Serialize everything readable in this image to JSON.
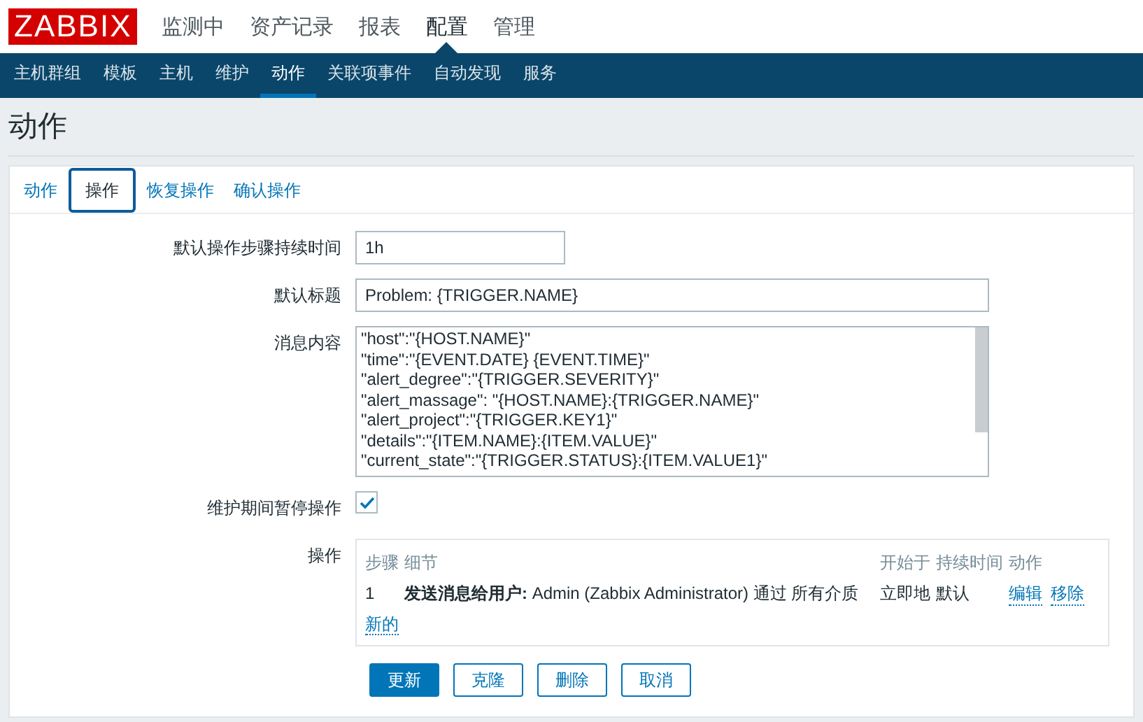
{
  "logo": "ZABBIX",
  "main_menu": [
    {
      "label": "监测中",
      "selected": false
    },
    {
      "label": "资产记录",
      "selected": false
    },
    {
      "label": "报表",
      "selected": false
    },
    {
      "label": "配置",
      "selected": true
    },
    {
      "label": "管理",
      "selected": false
    }
  ],
  "sub_menu": [
    {
      "label": "主机群组",
      "selected": false
    },
    {
      "label": "模板",
      "selected": false
    },
    {
      "label": "主机",
      "selected": false
    },
    {
      "label": "维护",
      "selected": false
    },
    {
      "label": "动作",
      "selected": true
    },
    {
      "label": "关联项事件",
      "selected": false
    },
    {
      "label": "自动发现",
      "selected": false
    },
    {
      "label": "服务",
      "selected": false
    }
  ],
  "page_title": "动作",
  "tabs": [
    {
      "label": "动作",
      "selected": false
    },
    {
      "label": "操作",
      "selected": true
    },
    {
      "label": "恢复操作",
      "selected": false
    },
    {
      "label": "确认操作",
      "selected": false
    }
  ],
  "form": {
    "step_duration": {
      "label": "默认操作步骤持续时间",
      "value": "1h"
    },
    "subject": {
      "label": "默认标题",
      "value": "Problem: {TRIGGER.NAME}"
    },
    "message": {
      "label": "消息内容",
      "lines": [
        "\"host\":\"{HOST.NAME}\"",
        "\"time\":\"{EVENT.DATE} {EVENT.TIME}\"",
        "\"alert_degree\":\"{TRIGGER.SEVERITY}\"",
        "\"alert_massage\": \"{HOST.NAME}:{TRIGGER.NAME}\"",
        "\"alert_project\":\"{TRIGGER.KEY1}\"",
        "\"details\":\"{ITEM.NAME}:{ITEM.VALUE}\"",
        "\"current_state\":\"{TRIGGER.STATUS}:{ITEM.VALUE1}\""
      ]
    },
    "pause": {
      "label": "维护期间暂停操作",
      "checked": true
    },
    "operations": {
      "label": "操作",
      "columns": [
        "步骤",
        "细节",
        "开始于",
        "持续时间",
        "动作"
      ],
      "rows": [
        {
          "step": "1",
          "details": "**发送消息给用户:** Admin (Zabbix Administrator) 通过 所有介质",
          "start": "立即地",
          "duration": "默认",
          "actions": [
            "编辑",
            "移除"
          ]
        }
      ],
      "new_link": "新的"
    },
    "buttons": [
      {
        "label": "更新",
        "kind": "primary"
      },
      {
        "label": "克隆",
        "kind": "secondary"
      },
      {
        "label": "删除",
        "kind": "secondary"
      },
      {
        "label": "取消",
        "kind": "secondary"
      }
    ]
  }
}
